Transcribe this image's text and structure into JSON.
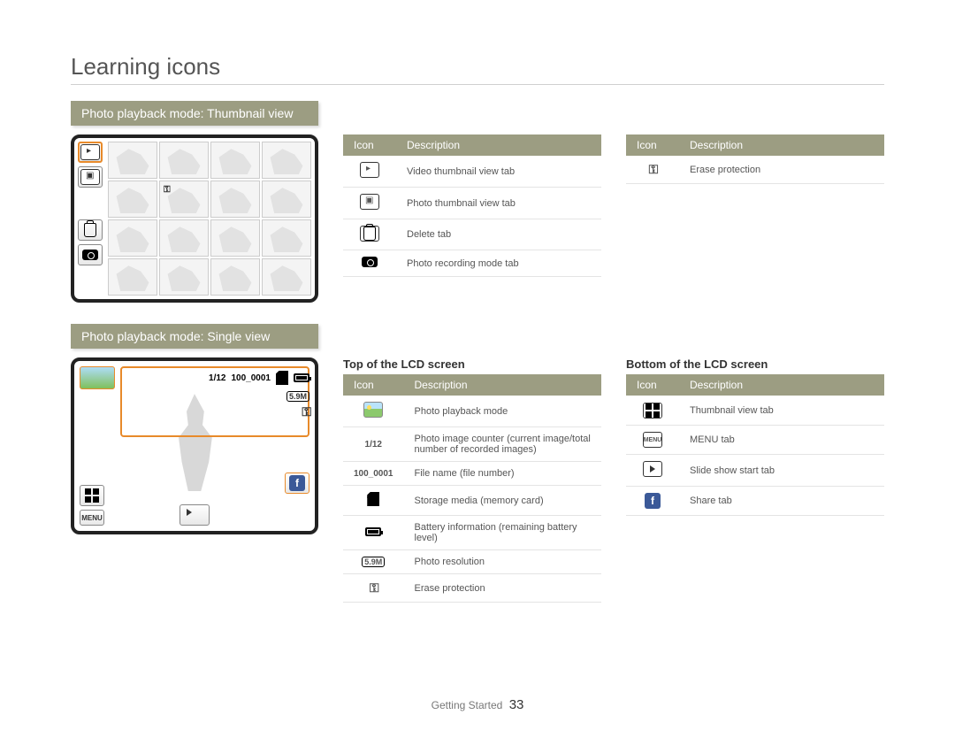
{
  "page_title": "Learning icons",
  "section1_title": "Photo playback mode: Thumbnail view",
  "section2_title": "Photo playback mode: Single view",
  "table_headers": {
    "icon": "Icon",
    "desc": "Description"
  },
  "thumb_table": [
    {
      "desc": "Video thumbnail view tab"
    },
    {
      "desc": "Photo thumbnail view tab"
    },
    {
      "desc": "Delete tab"
    },
    {
      "desc": "Photo recording mode tab"
    }
  ],
  "thumb_table2": [
    {
      "desc": "Erase protection"
    }
  ],
  "top_title": "Top of the LCD screen",
  "top_table": [
    {
      "icon_text": "",
      "desc": "Photo playback mode"
    },
    {
      "icon_text": "1/12",
      "desc": "Photo image counter (current image/total number of recorded images)"
    },
    {
      "icon_text": "100_0001",
      "desc": "File name (file number)"
    },
    {
      "icon_text": "",
      "desc": "Storage media (memory card)"
    },
    {
      "icon_text": "",
      "desc": "Battery information (remaining battery level)"
    },
    {
      "icon_text": "",
      "desc": "Photo resolution"
    },
    {
      "icon_text": "",
      "desc": "Erase protection"
    }
  ],
  "bottom_title": "Bottom of the LCD screen",
  "bottom_table": [
    {
      "desc": "Thumbnail view tab"
    },
    {
      "desc": "MENU tab"
    },
    {
      "desc": "Slide show start tab"
    },
    {
      "desc": "Share tab"
    }
  ],
  "single_view": {
    "counter": "1/12",
    "filename": "100_0001",
    "res_label": "5.9M",
    "menu_label": "MENU"
  },
  "footer_section": "Getting Started",
  "footer_page": "33"
}
